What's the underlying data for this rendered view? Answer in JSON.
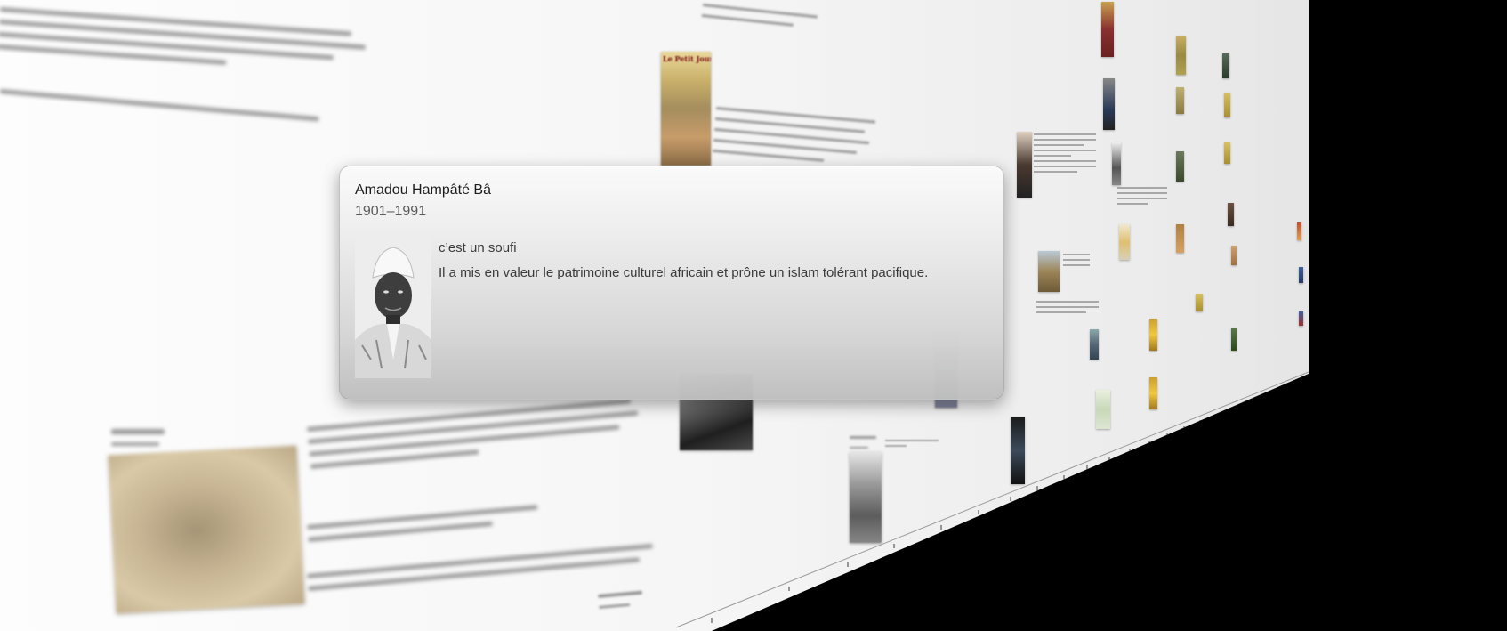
{
  "popup": {
    "name": "Amadou Hampâté Bâ",
    "dates": "1901–1991",
    "portrait_icon": "portrait-photo",
    "tagline": "c’est un soufi",
    "description": "Il a mis en valeur le patrimoine culturel africain et prône un islam tolérant pacifique."
  },
  "background": {
    "newspaper_label": "Le Petit Journal"
  },
  "colors": {
    "wall": "#f6f6f6",
    "outside": "#000000",
    "popup_top": "#fafafa",
    "popup_bottom": "#bebebe"
  }
}
